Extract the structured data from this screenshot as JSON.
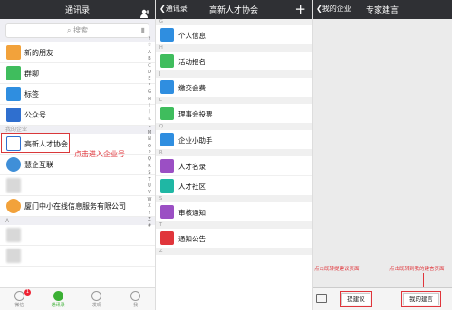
{
  "panel1": {
    "title": "通讯录",
    "search_placeholder": "搜索",
    "items": [
      {
        "label": "新的朋友",
        "icon": "add-friend-icon",
        "color": "#f2a23b"
      },
      {
        "label": "群聊",
        "icon": "group-chat-icon",
        "color": "#3fbd5d"
      },
      {
        "label": "标签",
        "icon": "tag-icon",
        "color": "#2f8ee0"
      },
      {
        "label": "公众号",
        "icon": "official-account-icon",
        "color": "#2f6fcf"
      }
    ],
    "section_enterprise": "我的企业",
    "enterprise_items": [
      {
        "label": "高新人才协会",
        "icon": "association-logo-icon"
      },
      {
        "label": "慧企互联",
        "icon": "huiqi-logo-icon"
      }
    ],
    "contact_label": "厦门中小在线信息服务有限公司",
    "section_a": "A",
    "hint": "点击进入企业号",
    "index_letters": [
      "↑",
      "☆",
      "A",
      "B",
      "C",
      "D",
      "E",
      "F",
      "G",
      "H",
      "I",
      "J",
      "K",
      "L",
      "M",
      "N",
      "O",
      "P",
      "Q",
      "R",
      "S",
      "T",
      "U",
      "V",
      "W",
      "X",
      "Y",
      "Z",
      "#"
    ],
    "tabs": [
      {
        "label": "微信",
        "badge": "1"
      },
      {
        "label": "通讯录",
        "active": true
      },
      {
        "label": "发现"
      },
      {
        "label": "我"
      }
    ]
  },
  "panel2": {
    "back": "通讯录",
    "title": "高新人才协会",
    "plus": "+",
    "groups": [
      {
        "letter": "G",
        "items": [
          {
            "label": "个人信息",
            "icon": "id-card-icon",
            "color": "#2f8ee0"
          }
        ]
      },
      {
        "letter": "H",
        "items": [
          {
            "label": "活动报名",
            "icon": "activity-icon",
            "color": "#3fbd5d"
          }
        ]
      },
      {
        "letter": "J",
        "items": [
          {
            "label": "缴交会费",
            "icon": "payment-icon",
            "color": "#2f8ee0"
          }
        ]
      },
      {
        "letter": "L",
        "items": [
          {
            "label": "理事会投票",
            "icon": "vote-icon",
            "color": "#3fbd5d"
          }
        ]
      },
      {
        "letter": "Q",
        "items": [
          {
            "label": "企业小助手",
            "icon": "assistant-icon",
            "color": "#2f8ee0"
          }
        ]
      },
      {
        "letter": "R",
        "items": [
          {
            "label": "人才名录",
            "icon": "talent-list-icon",
            "color": "#9b4fc4"
          },
          {
            "label": "人才社区",
            "icon": "community-icon",
            "color": "#1fb7a4"
          }
        ]
      },
      {
        "letter": "S",
        "items": [
          {
            "label": "审核通知",
            "icon": "review-icon",
            "color": "#9b4fc4"
          }
        ]
      },
      {
        "letter": "T",
        "items": [
          {
            "label": "通知公告",
            "icon": "announcement-icon",
            "color": "#e0353b"
          }
        ]
      },
      {
        "letter": "Z",
        "items": []
      }
    ]
  },
  "panel3": {
    "back": "我的企业",
    "title": "专家建言",
    "note_left": "点击既转提建议页面",
    "note_right": "点击既转到我的建言页面",
    "btn_left": "提建议",
    "btn_right": "我的建言"
  }
}
